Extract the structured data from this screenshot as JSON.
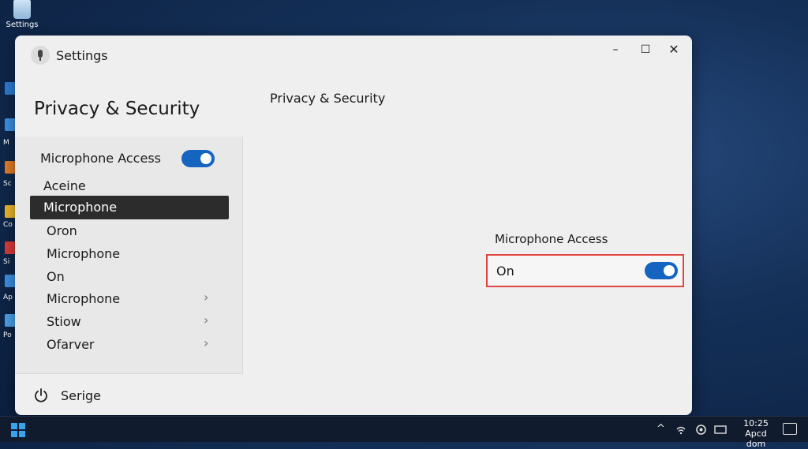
{
  "desktop": {
    "recycle_label": "Settings",
    "side_labels": [
      "M",
      "Sc",
      "Co",
      "Si",
      "Ap",
      "Po"
    ]
  },
  "window": {
    "title": "Settings",
    "controls": {
      "minimize": "–",
      "maximize": "☐",
      "close": "✕"
    }
  },
  "page": {
    "title": "Privacy & Security",
    "heading": "Privacy & Security"
  },
  "nav": {
    "header": "Microphone Access",
    "header_toggle_on": true,
    "items": [
      {
        "label": "Aceine",
        "selected": false,
        "chevron": false
      },
      {
        "label": "Microphone",
        "selected": true,
        "chevron": false
      },
      {
        "label": "Oron",
        "selected": false,
        "chevron": false
      },
      {
        "label": "Microphone",
        "selected": false,
        "chevron": false
      },
      {
        "label": "On",
        "selected": false,
        "chevron": false
      },
      {
        "label": "Microphone",
        "selected": false,
        "chevron": true
      },
      {
        "label": "Stiow",
        "selected": false,
        "chevron": true
      },
      {
        "label": "Ofarver",
        "selected": false,
        "chevron": true
      }
    ],
    "chevron_glyph": "›"
  },
  "footer": {
    "label": "Serige"
  },
  "setting": {
    "label": "Microphone Access",
    "value_text": "On",
    "toggle_on": true
  },
  "taskbar": {
    "tray_up": "^",
    "time": "10:25",
    "date": "Apcd dom"
  },
  "colors": {
    "accent": "#1565c0",
    "highlight_border": "#e0463f",
    "selected_bg": "#2c2c2c"
  }
}
